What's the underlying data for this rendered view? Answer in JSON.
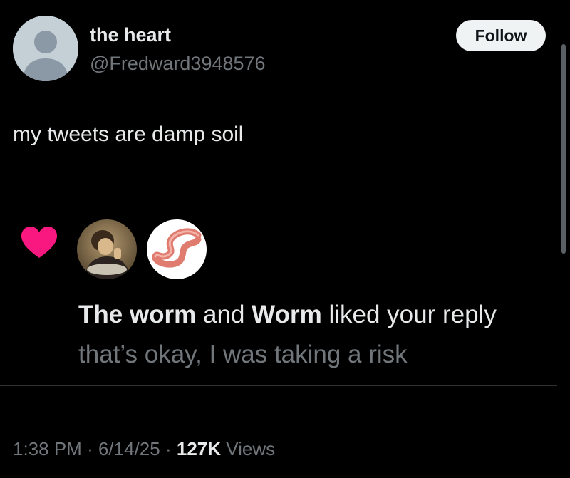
{
  "user": {
    "display_name": "the heart",
    "handle": "@Fredward3948576",
    "avatar_icon": "default-avatar-icon"
  },
  "follow_label": "Follow",
  "tweet_text": "my tweets are damp soil",
  "notification": {
    "icon": "heart-icon",
    "icon_color": "#f91880",
    "liker_1": "The worm",
    "connector": "and",
    "liker_2": "Worm",
    "action": "liked your reply",
    "reply_text": "that’s okay, I was taking a risk"
  },
  "meta": {
    "time": "1:38 PM",
    "sep1": "·",
    "date": "6/14/25",
    "sep2": "·",
    "views_count": "127K",
    "views_label": "Views"
  },
  "colors": {
    "background": "#000000",
    "text": "#e7e9ea",
    "muted": "#71767b",
    "divider": "#2f3336",
    "follow_bg": "#eff3f4"
  }
}
